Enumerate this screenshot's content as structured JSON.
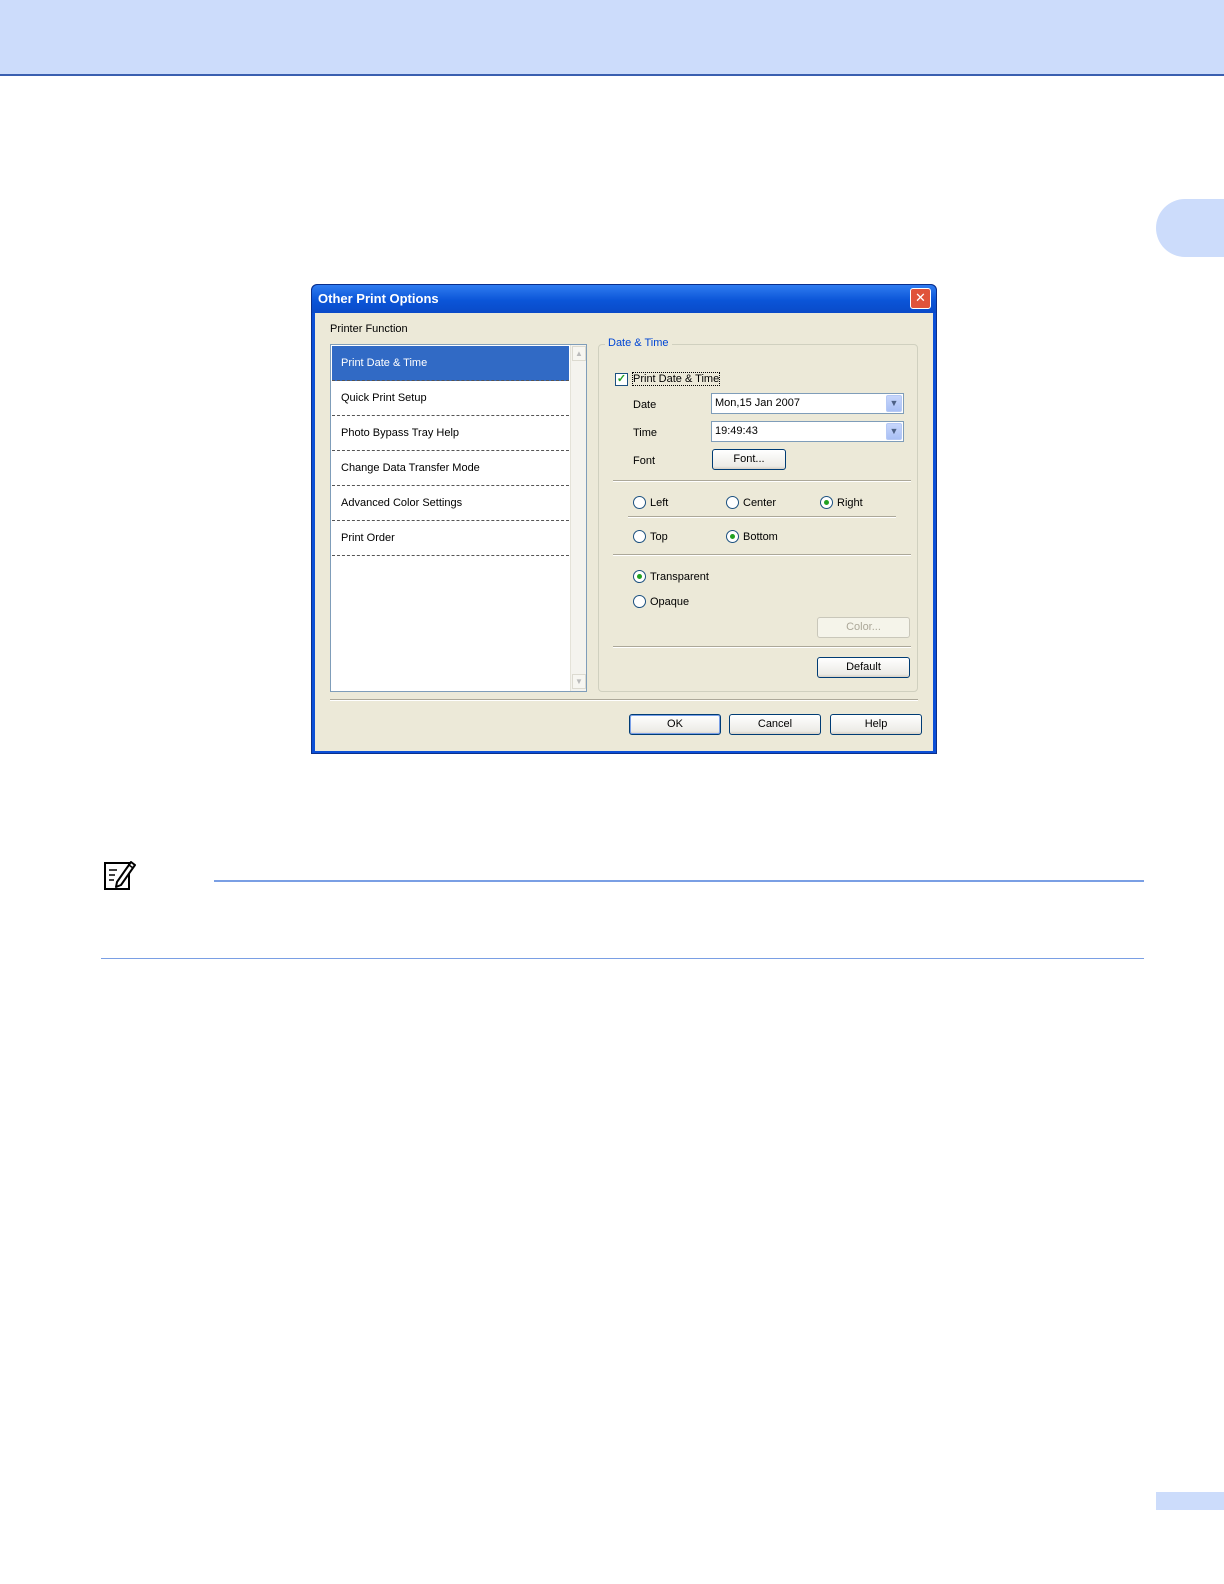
{
  "dialog": {
    "title": "Other Print Options",
    "close_glyph": "✕",
    "printer_function_label": "Printer Function",
    "list_items": [
      "Print Date & Time",
      "Quick Print Setup",
      "Photo Bypass Tray Help",
      "Change Data Transfer Mode",
      "Advanced Color Settings",
      "Print Order"
    ],
    "selected_index": 0,
    "group_title": "Date & Time",
    "print_date_time": {
      "label": "Print Date & Time",
      "checked": true,
      "check_glyph": "✓"
    },
    "date": {
      "label": "Date",
      "value": "Mon,15 Jan 2007"
    },
    "time": {
      "label": "Time",
      "value": "19:49:43"
    },
    "font": {
      "label": "Font",
      "button": "Font..."
    },
    "horizontal": {
      "left": "Left",
      "center": "Center",
      "right": "Right",
      "selected": "right"
    },
    "vertical": {
      "top": "Top",
      "bottom": "Bottom",
      "selected": "bottom"
    },
    "background": {
      "transparent": "Transparent",
      "opaque": "Opaque",
      "selected": "transparent"
    },
    "color_button": "Color...",
    "default_button": "Default",
    "ok_button": "OK",
    "cancel_button": "Cancel",
    "help_button": "Help",
    "scroll_up_glyph": "▲",
    "scroll_down_glyph": "▼",
    "combo_glyph": "▼"
  },
  "colors": {
    "header_band": "#ccdcfb",
    "title_bar": "#0b55d8",
    "selection": "#316ac5",
    "dialog_face": "#ece9d8",
    "note_rule": "#7a9fe4"
  }
}
